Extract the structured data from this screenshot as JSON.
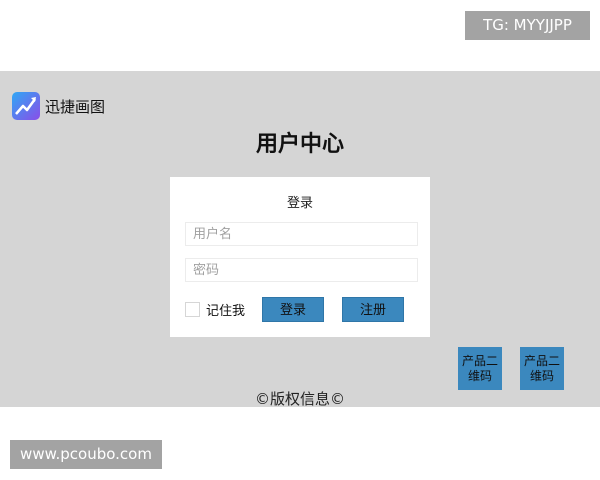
{
  "watermarks": {
    "top": "TG: MYYJJPP",
    "bottom": "www.pcoubo.com"
  },
  "header": {
    "logo_icon": "chart-trend-icon",
    "logo_text": "迅捷画图",
    "page_title": "用户中心"
  },
  "login_form": {
    "title": "登录",
    "username": {
      "value": "",
      "placeholder": "用户名"
    },
    "password": {
      "value": "",
      "placeholder": "密码"
    },
    "remember_label": "记住我",
    "remember_checked": false,
    "login_label": "登录",
    "register_label": "注册"
  },
  "qr_codes": [
    {
      "label": "产品二维码"
    },
    {
      "label": "产品二维码"
    }
  ],
  "footer": {
    "copyright": "©版权信息©"
  },
  "colors": {
    "canvas_bg": "#d5d5d5",
    "button_blue": "#3b88be",
    "watermark_bg": "#a3a3a3"
  }
}
